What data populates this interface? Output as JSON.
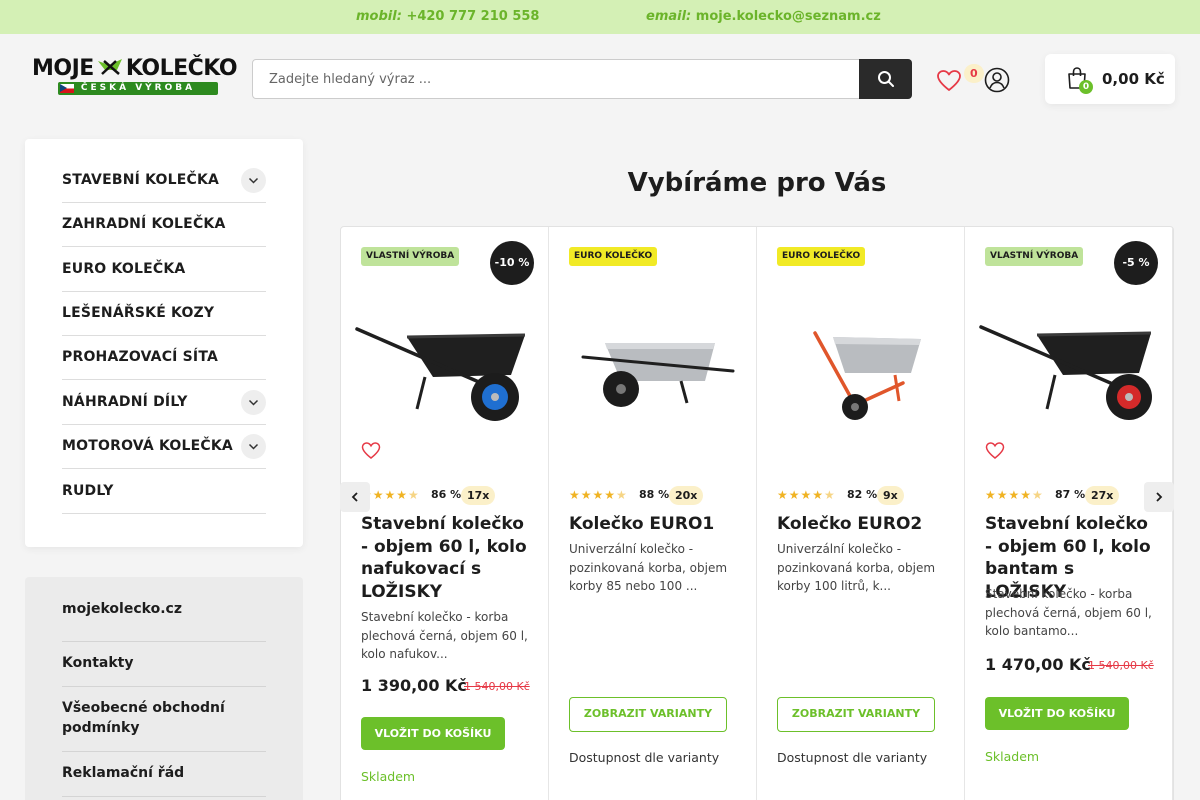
{
  "topbar": {
    "phone_label": "mobil:",
    "phone": "+420 777 210 558",
    "email_label": "email:",
    "email": "moje.kolecko@seznam.cz"
  },
  "logo": {
    "text": "MOJE KOLEČKO",
    "subtitle": "ČESKÁ VÝROBA"
  },
  "search": {
    "placeholder": "Zadejte hledaný výraz ..."
  },
  "wishlist": {
    "count": "0"
  },
  "cart": {
    "count": "0",
    "total": "0,00 Kč"
  },
  "categories": [
    {
      "label": "STAVEBNÍ KOLEČKA",
      "expandable": true
    },
    {
      "label": "ZAHRADNÍ KOLEČKA",
      "expandable": false
    },
    {
      "label": "EURO KOLEČKA",
      "expandable": false
    },
    {
      "label": "LEŠENÁŘSKÉ KOZY",
      "expandable": false
    },
    {
      "label": "PROHAZOVACÍ SÍTA",
      "expandable": false
    },
    {
      "label": "NÁHRADNÍ DÍLY",
      "expandable": true
    },
    {
      "label": "MOTOROVÁ KOLEČKA",
      "expandable": true
    },
    {
      "label": "RUDLY",
      "expandable": false
    }
  ],
  "info_links": [
    {
      "label": "mojekolecko.cz"
    },
    {
      "label": "Kontakty"
    },
    {
      "label": "Všeobecné obchodní podmínky"
    },
    {
      "label": "Reklamační řád"
    }
  ],
  "section": {
    "title": "Vybíráme pro Vás"
  },
  "products": [
    {
      "tag": "VLASTNÍ VÝROBA",
      "tag_type": "own",
      "discount": "-10 %",
      "rating_pct": "86 %",
      "rating_count": "17x",
      "stars": 4.5,
      "name": "Stavební kolečko - objem 60 l, kolo nafukovací s LOŽISKY",
      "desc": "Stavební kolečko - korba plechová černá, objem 60 l, kolo nafukov...",
      "price": "1 390,00 Kč",
      "old_price": "1 540,00 Kč",
      "button": "VLOŽIT DO KOŠÍKU",
      "button_type": "buy",
      "status": "Skladem",
      "status_type": "stock",
      "image": "wheelbarrow-black-blue-wheel",
      "colors": {
        "body": "#1f1f1f",
        "wheel": "#1f6fd1"
      }
    },
    {
      "tag": "EURO KOLEČKO",
      "tag_type": "euro",
      "discount": "",
      "rating_pct": "88 %",
      "rating_count": "20x",
      "stars": 4.5,
      "name": "Kolečko EURO1",
      "desc": "Univerzální kolečko - pozinkovaná korba, objem korby 85 nebo 100 ...",
      "price": "",
      "old_price": "",
      "button": "ZOBRAZIT VARIANTY",
      "button_type": "variants",
      "status": "Dostupnost dle varianty",
      "status_type": "avail",
      "image": "wheelbarrow-galvanized-black-frame",
      "colors": {
        "body": "#b9bcc0",
        "wheel": "#1f1f1f"
      }
    },
    {
      "tag": "EURO KOLEČKO",
      "tag_type": "euro",
      "discount": "",
      "rating_pct": "82 %",
      "rating_count": "9x",
      "stars": 4.5,
      "name": "Kolečko EURO2",
      "desc": "Univerzální kolečko - pozinkovaná korba, objem korby 100 litrů, k...",
      "price": "",
      "old_price": "",
      "button": "ZOBRAZIT VARIANTY",
      "button_type": "variants",
      "status": "Dostupnost dle varianty",
      "status_type": "avail",
      "image": "wheelbarrow-galvanized-orange-frame",
      "colors": {
        "body": "#b9bcc0",
        "wheel": "#e0562b"
      }
    },
    {
      "tag": "VLASTNÍ VÝROBA",
      "tag_type": "own",
      "discount": "-5 %",
      "rating_pct": "87 %",
      "rating_count": "27x",
      "stars": 4.5,
      "name": "Stavební kolečko - objem 60 l, kolo bantam s LOŽISKY",
      "desc": "Stavební kolečko - korba plechová černá, objem 60 l, kolo bantamo...",
      "price": "1 470,00 Kč",
      "old_price": "1 540,00 Kč",
      "button": "VLOŽIT DO KOŠÍKU",
      "button_type": "buy",
      "status": "Skladem",
      "status_type": "stock",
      "image": "wheelbarrow-black-red-wheel",
      "colors": {
        "body": "#1f1f1f",
        "wheel": "#d42a2a"
      }
    }
  ],
  "colors": {
    "accent": "#6cc02a",
    "topbar": "#d4f0b5",
    "sale": "#e63946",
    "dark": "#1d1d1d"
  }
}
